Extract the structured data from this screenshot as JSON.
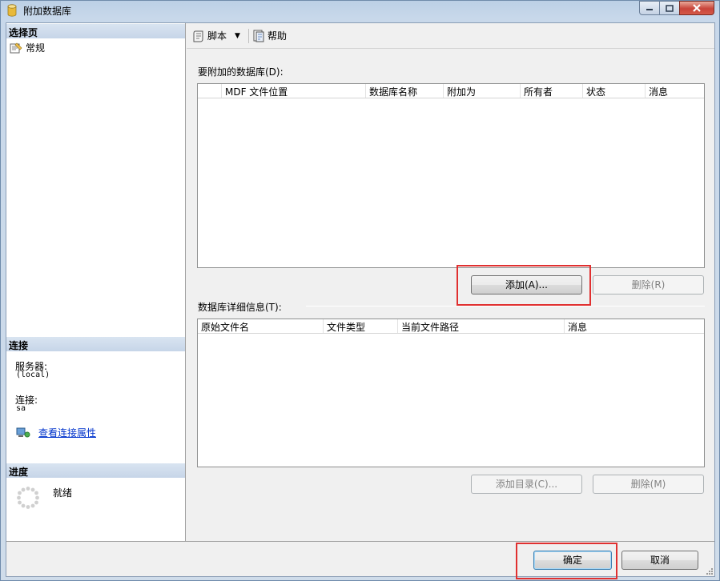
{
  "window": {
    "title": "附加数据库",
    "icon": "database-icon",
    "controls": [
      "minimize-icon",
      "maximize-icon",
      "close-icon"
    ]
  },
  "left_pane": {
    "select_page_header": "选择页",
    "pages": [
      {
        "label": "常规",
        "icon": "general-page-icon"
      }
    ],
    "connection_header": "连接",
    "server_label": "服务器:",
    "server_value": "(local)",
    "connection_label": "连接:",
    "connection_value": "sa",
    "view_connection_properties": "查看连接属性",
    "progress_header": "进度",
    "progress_status": "就绪"
  },
  "toolbar": {
    "script_label": "脚本",
    "help_label": "帮助"
  },
  "attach_section": {
    "label": "要附加的数据库(D):",
    "columns": [
      "MDF 文件位置",
      "数据库名称",
      "附加为",
      "所有者",
      "状态",
      "消息"
    ],
    "rows": [],
    "add_button": "添加(A)...",
    "remove_button": "删除(R)"
  },
  "details_section": {
    "label": "数据库详细信息(T):",
    "columns": [
      "原始文件名",
      "文件类型",
      "当前文件路径",
      "消息"
    ],
    "rows": [],
    "add_catalog_button": "添加目录(C)...",
    "remove_button": "删除(M)"
  },
  "footer": {
    "ok_button": "确定",
    "cancel_button": "取消"
  },
  "colors": {
    "highlight_box": "#e03030",
    "link": "#0033cc",
    "section_header": "#c6d5e8"
  }
}
